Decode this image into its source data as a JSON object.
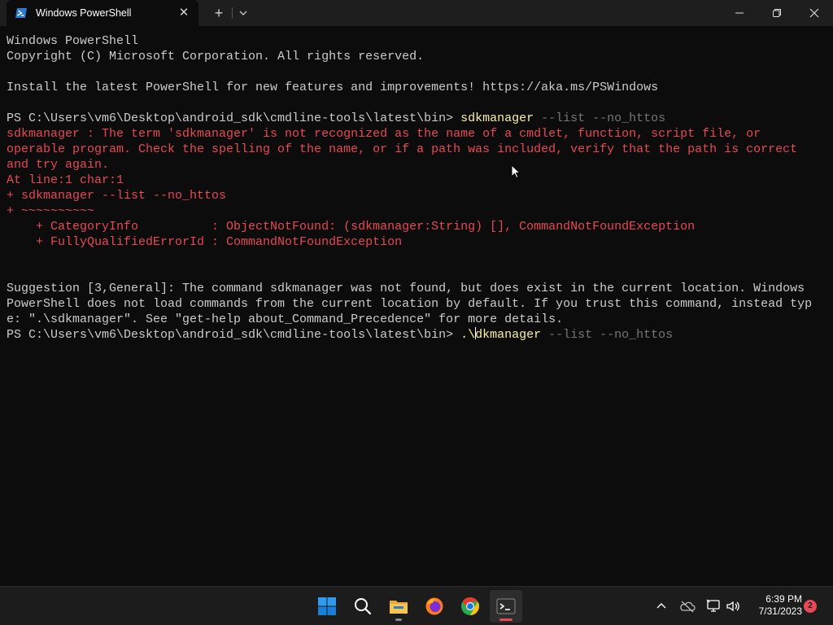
{
  "window": {
    "tab_title": "Windows PowerShell",
    "tab_close_glyph": "✕",
    "new_tab_glyph": "+"
  },
  "terminal": {
    "banner_1": "Windows PowerShell",
    "banner_2": "Copyright (C) Microsoft Corporation. All rights reserved.",
    "banner_3": "Install the latest PowerShell for new features and improvements! https://aka.ms/PSWindows",
    "prompt": "PS C:\\Users\\vm6\\Desktop\\android_sdk\\cmdline-tools\\latest\\bin> ",
    "cmd_1": "sdkmanager",
    "args_1": " --list --no_httos",
    "err_1": "sdkmanager : The term 'sdkmanager' is not recognized as the name of a cmdlet, function, script file, or",
    "err_2": "operable program. Check the spelling of the name, or if a path was included, verify that the path is correct",
    "err_3": "and try again.",
    "err_4": "At line:1 char:1",
    "err_5": "+ sdkmanager --list --no_httos",
    "err_6": "+ ~~~~~~~~~~",
    "err_7": "    + CategoryInfo          : ObjectNotFound: (sdkmanager:String) [], CommandNotFoundException",
    "err_8": "    + FullyQualifiedErrorId : CommandNotFoundException",
    "sugg_1": "Suggestion [3,General]: The command sdkmanager was not found, but does exist in the current location. Windows",
    "sugg_2": "PowerShell does not load commands from the current location by default. If you trust this command, instead typ",
    "sugg_3": "e: \".\\sdkmanager\". See \"get-help about_Command_Precedence\" for more details.",
    "cmd_2_before_caret": ".\\",
    "cmd_2_after_caret": "dkmanager",
    "args_2": " --list --no_httos"
  },
  "taskbar": {
    "time": "6:39 PM",
    "date": "7/31/2023",
    "notification_count": "2"
  },
  "colors": {
    "error": "#e74856",
    "command": "#f9f1a5",
    "argument": "#767676",
    "text": "#cccccc"
  },
  "icons": [
    "powershell-icon",
    "close-icon",
    "plus-icon",
    "chevron-down-icon",
    "minimize-icon",
    "maximize-icon",
    "window-close-icon",
    "windows-start-icon",
    "search-icon",
    "file-explorer-icon",
    "firefox-icon",
    "chrome-icon",
    "terminal-icon",
    "chevron-up-icon",
    "onedrive-icon",
    "network-icon",
    "volume-icon"
  ]
}
